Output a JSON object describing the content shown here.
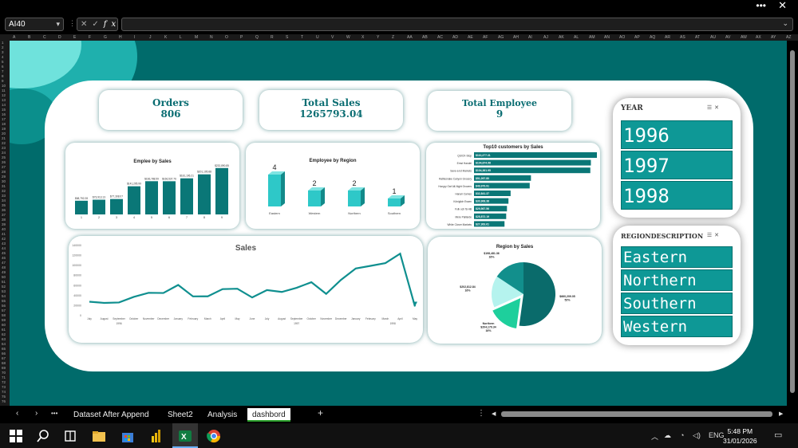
{
  "window": {
    "more_label": "•••",
    "close_label": "✕"
  },
  "formula_bar": {
    "name_box": "AI40",
    "formula": ""
  },
  "columns": [
    "A",
    "B",
    "C",
    "D",
    "E",
    "F",
    "G",
    "H",
    "I",
    "J",
    "K",
    "L",
    "M",
    "N",
    "O",
    "P",
    "Q",
    "R",
    "S",
    "T",
    "U",
    "V",
    "W",
    "X",
    "Y",
    "Z",
    "AA",
    "AB",
    "AC",
    "AD",
    "AE",
    "AF",
    "AG",
    "AH",
    "AI",
    "AJ",
    "AK",
    "AL",
    "AM",
    "AN",
    "AO",
    "AP",
    "AQ",
    "AR",
    "AS",
    "AT",
    "AU",
    "AV",
    "AW",
    "AX",
    "AY",
    "AZ"
  ],
  "kpis": {
    "orders": {
      "label": "Orders",
      "value": "806"
    },
    "sales": {
      "label": "Total Sales",
      "value": "1265793.04"
    },
    "employees": {
      "label": "Total Employee",
      "value": "9"
    }
  },
  "emp_by_sales": {
    "title": "Emplee by Sales",
    "categories": [
      "1",
      "2",
      "3",
      "4",
      "5",
      "6",
      "7",
      "8",
      "9"
    ],
    "values": [
      68792.28,
      73913.13,
      77308.07,
      141295.99,
      166788.59,
      166537.76,
      181196.21,
      201195.88,
      232890.85
    ],
    "labels": [
      "$68,792.28",
      "$73,913.13",
      "$77,308.07",
      "$141,295.99",
      "$166,788.59",
      "$166,537.76",
      "$181,196.21",
      "$201,195.88",
      "$232,890.85"
    ]
  },
  "emp_by_region": {
    "title": "Employee by Region",
    "categories": [
      "Eastern",
      "Western",
      "Northern",
      "Southern"
    ],
    "values": [
      4,
      2,
      2,
      1
    ]
  },
  "top10": {
    "title": "Top10 customers by Sales",
    "customers": [
      "QUICK-Stop",
      "Ernst Handel",
      "Save-a-lot Markets",
      "Rattlesnake Canyon Grocery",
      "Hungry Owl All-Night Grocers",
      "Hanari Carnes",
      "Königlich Essen",
      "Folk och fä HB",
      "Mère Paillarde",
      "White Clover Markets"
    ],
    "values": [
      110277.31,
      104874.98,
      104361.95,
      51097.8,
      49979.91,
      32841.37,
      30908.38,
      29567.56,
      28872.19,
      27363.61
    ],
    "labels": [
      "$110,277.31",
      "$104,874.98",
      "$104,361.95",
      "$51,097.80",
      "$49,979.91",
      "$32,841.37",
      "$30,908.38",
      "$29,567.56",
      "$28,872.19",
      "$27,363.61"
    ]
  },
  "sales_trend": {
    "title": "Sales",
    "y_ticks": [
      "140000",
      "120000",
      "100000",
      "80000",
      "60000",
      "40000",
      "20000",
      "0"
    ],
    "months": [
      "July",
      "August",
      "September",
      "October",
      "November",
      "December",
      "January",
      "February",
      "March",
      "April",
      "May",
      "June",
      "July",
      "August",
      "September",
      "October",
      "November",
      "December",
      "January",
      "February",
      "March",
      "April",
      "May"
    ],
    "years": [
      "1996",
      "1997",
      "1998"
    ],
    "values": [
      27861,
      25485,
      26382,
      37516,
      45601,
      45240,
      61259,
      38484,
      38548,
      53033,
      53781,
      36363,
      51020,
      47288,
      55629,
      66749,
      43533,
      71398,
      94222,
      99415,
      104854,
      123799,
      18334
    ]
  },
  "region_pie": {
    "title": "Region by Sales",
    "slices": [
      {
        "name": "",
        "value": 660209,
        "label": "$660,209.05",
        "pct": "52%",
        "color": "#0a6b6b"
      },
      {
        "name": "Northern",
        "value": 204179,
        "label": "$204,179.34",
        "pct": "16%",
        "color": "#1ecf9c"
      },
      {
        "name": "",
        "value": 202812,
        "label": "$202,812.84",
        "pct": "16%",
        "color": "#b5f3ee"
      },
      {
        "name": "",
        "value": 198481,
        "label": "$198,481.36",
        "pct": "16%",
        "color": "#128f8c"
      }
    ]
  },
  "year_slicer": {
    "title": "YEAR",
    "items": [
      "1996",
      "1997",
      "1998"
    ]
  },
  "region_slicer": {
    "title": "REGIONDESCRIPTION",
    "items": [
      "Eastern",
      "Northern",
      "Southern",
      "Western"
    ]
  },
  "tabs": [
    "Dataset After Append",
    "Sheet2",
    "Analysis",
    "dashbord"
  ],
  "nav": {
    "prev": "‹",
    "next": "›",
    "more": "•••",
    "add": "+",
    "options": "⋮"
  },
  "taskbar": {
    "time": "5:48 PM",
    "date": "31/01/2026",
    "lang": "ENG"
  },
  "colors": {
    "accent": "#0e9896",
    "background": "#006b6b",
    "kpi_text": "#0a6d72"
  }
}
